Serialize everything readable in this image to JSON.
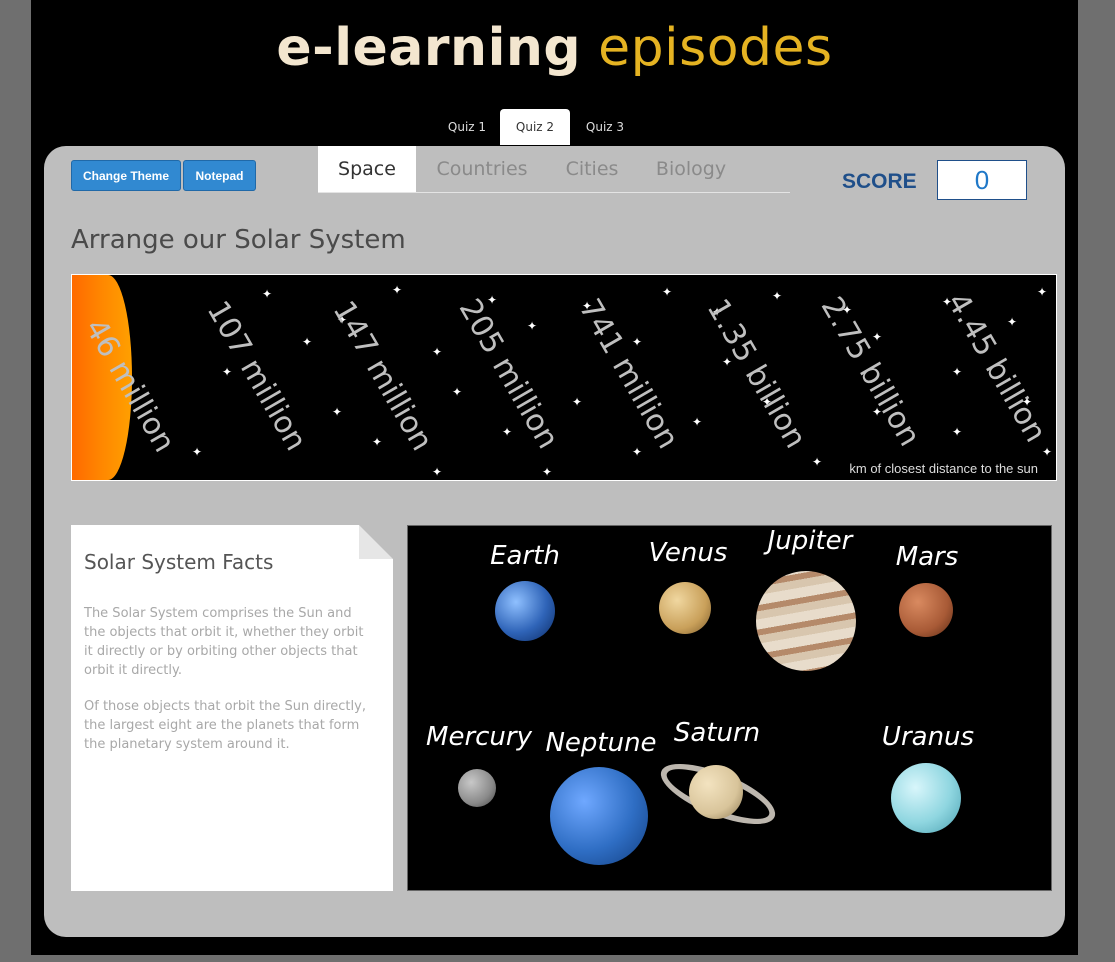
{
  "logo": {
    "part1": "e-learning",
    "part2": "episodes"
  },
  "quiz_tabs": [
    {
      "label": "Quiz 1",
      "active": false
    },
    {
      "label": "Quiz 2",
      "active": true
    },
    {
      "label": "Quiz 3",
      "active": false
    }
  ],
  "toolbar": {
    "change_theme_label": "Change Theme",
    "notepad_label": "Notepad"
  },
  "topic_tabs": [
    {
      "label": "Space",
      "active": true
    },
    {
      "label": "Countries",
      "active": false
    },
    {
      "label": "Cities",
      "active": false
    },
    {
      "label": "Biology",
      "active": false
    }
  ],
  "score": {
    "label": "SCORE",
    "value": "0"
  },
  "title": "Arrange our Solar System",
  "timeline": {
    "distances": [
      "46 million",
      "107 million",
      "147 million",
      "205 million",
      "741 million",
      "1.35 billion",
      "2.75 billion",
      "4.45 billion"
    ],
    "note": "km of closest distance to the sun"
  },
  "facts": {
    "title": "Solar System Facts",
    "p1": "The Solar System comprises the Sun and the objects that orbit it, whether they orbit it directly or by orbiting other objects that orbit it directly.",
    "p2": "Of those objects that orbit the Sun directly, the largest eight are the planets that form the planetary system around it."
  },
  "planets": [
    {
      "name": "Earth",
      "color": "#2f64b8"
    },
    {
      "name": "Venus",
      "color": "#c9a05a"
    },
    {
      "name": "Jupiter",
      "color": "#c8b49a"
    },
    {
      "name": "Mars",
      "color": "#a85a36"
    },
    {
      "name": "Mercury",
      "color": "#8a8a8a"
    },
    {
      "name": "Neptune",
      "color": "#2f6ec4"
    },
    {
      "name": "Saturn",
      "color": "#d8c49a"
    },
    {
      "name": "Uranus",
      "color": "#8fd6e0"
    }
  ]
}
